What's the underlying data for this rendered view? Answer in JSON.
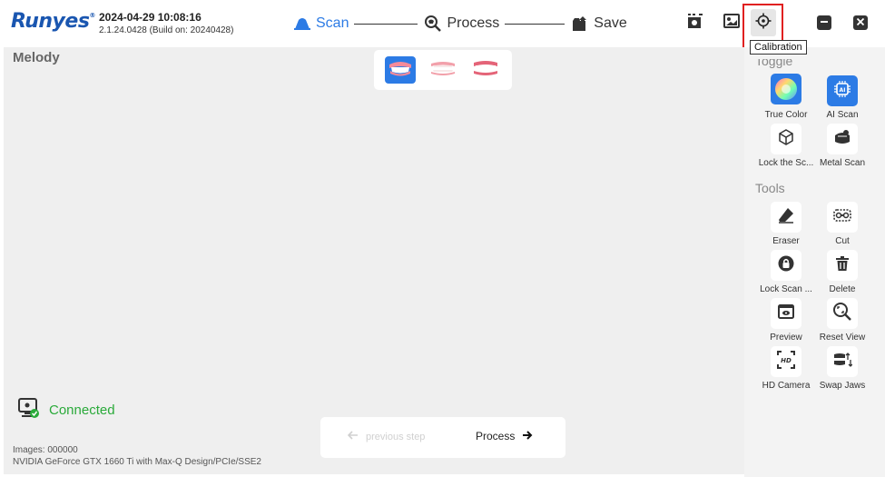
{
  "header": {
    "logo": "Runyes",
    "datetime": "2024-04-29 10:08:16",
    "version": "2.1.24.0428 (Build on: 20240428)",
    "steps": [
      {
        "label": "Scan",
        "icon": "scan-icon",
        "active": true
      },
      {
        "label": "Process",
        "icon": "process-icon",
        "active": false
      },
      {
        "label": "Save",
        "icon": "save-icon",
        "active": false
      }
    ],
    "calibration_tooltip": "Calibration"
  },
  "canvas": {
    "model_name": "Melody",
    "connection": "Connected",
    "prev_step": "previous step",
    "next_step": "Process"
  },
  "status": {
    "images": "Images: 000000",
    "gpu": "NVIDIA GeForce GTX 1660 Ti with Max-Q Design/PCIe/SSE2"
  },
  "panel": {
    "toggle_title": "Toggle",
    "tools_title": "Tools",
    "toggle_buttons": [
      {
        "label": "True Color",
        "icon": "true-color-icon"
      },
      {
        "label": "AI Scan",
        "icon": "ai-scan-icon"
      },
      {
        "label": "Lock the Sc...",
        "icon": "lock-scan-icon"
      },
      {
        "label": "Metal Scan",
        "icon": "metal-scan-icon"
      }
    ],
    "tool_buttons": [
      {
        "label": "Eraser",
        "icon": "eraser-icon"
      },
      {
        "label": "Cut",
        "icon": "cut-icon"
      },
      {
        "label": "Lock Scan ...",
        "icon": "lock-icon"
      },
      {
        "label": "Delete",
        "icon": "trash-icon"
      },
      {
        "label": "Preview",
        "icon": "preview-icon"
      },
      {
        "label": "Reset View",
        "icon": "reset-view-icon"
      },
      {
        "label": "HD Camera",
        "icon": "hd-camera-icon"
      },
      {
        "label": "Swap Jaws",
        "icon": "swap-jaws-icon"
      }
    ]
  },
  "colors": {
    "accent": "#2c7be5",
    "brand": "#1a56b0",
    "connected": "#2aaa3a",
    "highlight": "#e02020"
  }
}
